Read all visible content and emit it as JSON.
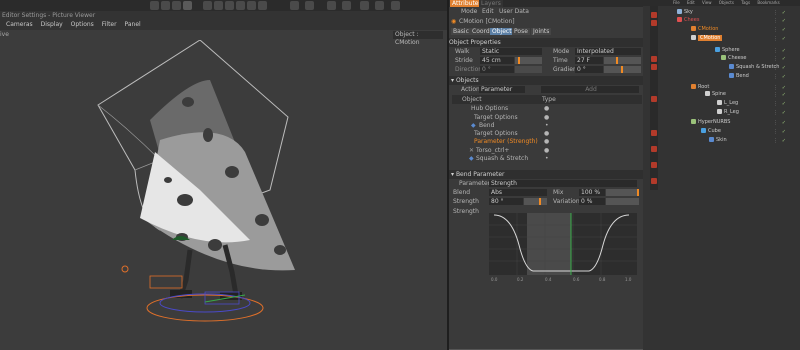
{
  "viewport": {
    "title": "Editor Settings - Picture Viewer",
    "menu": [
      "Cameras",
      "Display",
      "Options",
      "Filter",
      "Panel"
    ],
    "view_label": "ive",
    "object_label": "Object : CMotion"
  },
  "attr": {
    "top_tabs": [
      "Attributes",
      "Layers"
    ],
    "menu": [
      "Mode",
      "Edit",
      "User Data"
    ],
    "object_title": "CMotion [CMotion]",
    "tabs": [
      "Basic",
      "Coord.",
      "Object",
      "Pose",
      "Joints"
    ],
    "section_props": "Object Properties",
    "walk_label": "Walk",
    "walk_value": "Static",
    "mode_label": "Mode",
    "mode_value": "Interpolated",
    "stride_label": "Stride",
    "stride_value": "45 cm",
    "time_label": "Time",
    "time_value": "27 F",
    "direction_label": "Direction",
    "direction_value": "0 °",
    "gradient_label": "Gradient",
    "gradient_value": "0 °",
    "section_objects": "Objects",
    "action_label": "Action",
    "action_value": "Parameter",
    "add_label": "Add",
    "col_object": "Object",
    "col_type": "Type",
    "items": [
      "Hub Options",
      "Target Options",
      "Bend",
      "Target Options",
      "Parameter (Strength)",
      "Torso_ctrl+",
      "Squash & Stretch"
    ],
    "section_bend": "Bend Parameter",
    "parameter_label": "Parameter",
    "parameter_value": "Strength",
    "blend_label": "Blend",
    "blend_value": "Abs",
    "mix_label": "Mix",
    "mix_value": "100 %",
    "strength_label": "Strength",
    "strength_value": "80 °",
    "variation_label": "Variation",
    "variation_value": "0 %",
    "strength_curve_label": "Strength",
    "curve_ticks": [
      "0.0",
      "0.2",
      "0.4",
      "0.6",
      "0.8",
      "1.0"
    ]
  },
  "objmgr": {
    "menu": [
      "File",
      "Edit",
      "View",
      "Objects",
      "Tags",
      "Bookmarks"
    ],
    "rows": [
      {
        "label": "Sky",
        "color": "#8fb2d8",
        "indent": 10
      },
      {
        "label": "Chees",
        "color": "#e05050",
        "indent": 10
      },
      {
        "label": "CMotion",
        "color": "#e08030",
        "indent": 24
      },
      {
        "label": "CMotion",
        "color": "#d0d0d0",
        "indent": 24
      },
      {
        "label": "Sphere",
        "color": "#4aa0e0",
        "indent": 48
      },
      {
        "label": "Cheese",
        "color": "#9ac27a",
        "indent": 54
      },
      {
        "label": "Squash & Stretch",
        "color": "#5a8ad0",
        "indent": 62
      },
      {
        "label": "Bend",
        "color": "#5a8ad0",
        "indent": 62
      },
      {
        "label": "Root",
        "color": "#e08030",
        "indent": 24
      },
      {
        "label": "Spine",
        "color": "#d0d0d0",
        "indent": 38
      },
      {
        "label": "L_Leg",
        "color": "#d0d0d0",
        "indent": 50
      },
      {
        "label": "R_Leg",
        "color": "#d0d0d0",
        "indent": 50
      },
      {
        "label": "HyperNURBS",
        "color": "#9ac27a",
        "indent": 24
      },
      {
        "label": "Cube",
        "color": "#4aa0e0",
        "indent": 34
      },
      {
        "label": "Skin",
        "color": "#5a8ad0",
        "indent": 42
      }
    ]
  },
  "colors": {
    "accent": "#f08a24",
    "tab_active": "#5b7fa5"
  }
}
